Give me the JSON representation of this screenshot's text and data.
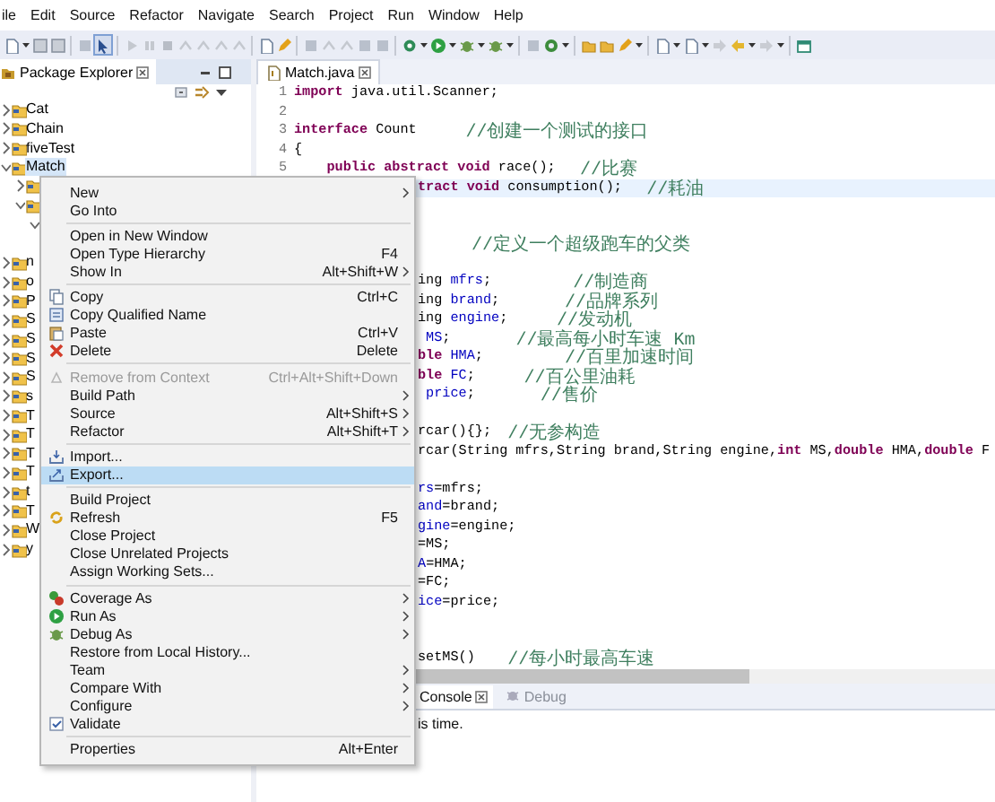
{
  "menubar": [
    "ile",
    "Edit",
    "Source",
    "Refactor",
    "Navigate",
    "Search",
    "Project",
    "Run",
    "Window",
    "Help"
  ],
  "explorer": {
    "title": "Package Explorer",
    "items": [
      {
        "label": "Cat",
        "expanded": false,
        "selected": false
      },
      {
        "label": "Chain",
        "expanded": false,
        "selected": false
      },
      {
        "label": "fiveTest",
        "expanded": false,
        "selected": false
      },
      {
        "label": "Match",
        "expanded": true,
        "selected": true,
        "children": [
          {
            "expanded": false
          },
          {
            "expanded": true,
            "children": [
              {
                "expanded": true
              }
            ]
          }
        ]
      },
      {
        "label": "n",
        "expanded": false,
        "selected": false
      },
      {
        "label": "o",
        "expanded": false,
        "selected": false
      },
      {
        "label": "P",
        "expanded": false,
        "selected": false
      },
      {
        "label": "S",
        "expanded": false,
        "selected": false
      },
      {
        "label": "S",
        "expanded": false,
        "selected": false
      },
      {
        "label": "S",
        "expanded": false,
        "selected": false
      },
      {
        "label": "S",
        "expanded": false,
        "selected": false
      },
      {
        "label": "s",
        "expanded": false,
        "selected": false
      },
      {
        "label": "T",
        "expanded": false,
        "selected": false
      },
      {
        "label": "T",
        "expanded": false,
        "selected": false
      },
      {
        "label": "T",
        "expanded": false,
        "selected": false
      },
      {
        "label": "T",
        "expanded": false,
        "selected": false
      },
      {
        "label": "t",
        "expanded": false,
        "selected": false
      },
      {
        "label": "T",
        "expanded": false,
        "selected": false
      },
      {
        "label": "W",
        "expanded": false,
        "selected": false
      },
      {
        "label": "y",
        "expanded": false,
        "selected": false
      }
    ]
  },
  "editor": {
    "tab": "Match.java",
    "lines": [
      {
        "number": "1",
        "highlighted": false,
        "segments": [
          {
            "kind": "keyword",
            "text": "import"
          },
          {
            "kind": "plain",
            "text": " java.util.Scanner;"
          }
        ]
      },
      {
        "number": "2",
        "highlighted": false
      },
      {
        "number": "3",
        "highlighted": false,
        "segments": [
          {
            "kind": "keyword",
            "text": "interface"
          },
          {
            "kind": "plain",
            "text": " Count      "
          },
          {
            "kind": "comment",
            "text": "//创建一个测试的接口"
          }
        ]
      },
      {
        "number": "4",
        "highlighted": false,
        "segments": [
          {
            "kind": "plain",
            "text": "{"
          }
        ]
      },
      {
        "number": "5",
        "highlighted": false,
        "segments": [
          {
            "kind": "keyword",
            "text": "    public abstract void"
          },
          {
            "kind": "plain",
            "text": " race();   "
          },
          {
            "kind": "comment",
            "text": "//比赛"
          }
        ]
      },
      {
        "highlighted": true,
        "segments": [
          {
            "kind": "keyword",
            "text": "tract void"
          },
          {
            "kind": "plain",
            "text": " consumption();   "
          },
          {
            "kind": "comment",
            "text": "//耗油"
          }
        ]
      },
      {
        "highlighted": false
      },
      {
        "highlighted": false
      },
      {
        "highlighted": false,
        "segments": [
          {
            "kind": "comment",
            "text": "     //定义一个超级跑车的父类"
          }
        ]
      },
      {
        "highlighted": false
      },
      {
        "highlighted": false,
        "segments": [
          {
            "kind": "plain",
            "text": "ing "
          },
          {
            "kind": "field",
            "text": "mfrs"
          },
          {
            "kind": "plain",
            "text": ";          "
          },
          {
            "kind": "comment",
            "text": "//制造商"
          }
        ]
      },
      {
        "highlighted": false,
        "segments": [
          {
            "kind": "plain",
            "text": "ing "
          },
          {
            "kind": "field",
            "text": "brand"
          },
          {
            "kind": "plain",
            "text": ";        "
          },
          {
            "kind": "comment",
            "text": "//品牌系列"
          }
        ]
      },
      {
        "highlighted": false,
        "segments": [
          {
            "kind": "plain",
            "text": "ing "
          },
          {
            "kind": "field",
            "text": "engine"
          },
          {
            "kind": "plain",
            "text": ";      "
          },
          {
            "kind": "comment",
            "text": "//发动机"
          }
        ]
      },
      {
        "highlighted": false,
        "segments": [
          {
            "kind": "field",
            "text": " MS"
          },
          {
            "kind": "plain",
            "text": ";        "
          },
          {
            "kind": "comment",
            "text": "//最高每小时车速 Km"
          }
        ]
      },
      {
        "highlighted": false,
        "segments": [
          {
            "kind": "keyword",
            "text": "ble"
          },
          {
            "kind": "field",
            "text": " HMA"
          },
          {
            "kind": "plain",
            "text": ";          "
          },
          {
            "kind": "comment",
            "text": "//百里加速时间"
          }
        ]
      },
      {
        "highlighted": false,
        "segments": [
          {
            "kind": "keyword",
            "text": "ble"
          },
          {
            "kind": "field",
            "text": " FC"
          },
          {
            "kind": "plain",
            "text": ";      "
          },
          {
            "kind": "comment",
            "text": "//百公里油耗"
          }
        ]
      },
      {
        "highlighted": false,
        "segments": [
          {
            "kind": "field",
            "text": " price"
          },
          {
            "kind": "plain",
            "text": ";        "
          },
          {
            "kind": "comment",
            "text": "//售价"
          }
        ]
      },
      {
        "highlighted": false
      },
      {
        "highlighted": false,
        "segments": [
          {
            "kind": "plain",
            "text": "rcar(){};  "
          },
          {
            "kind": "comment",
            "text": "//无参构造"
          }
        ]
      },
      {
        "highlighted": false,
        "segments": [
          {
            "kind": "plain",
            "text": "rcar(String mfrs,String brand,String engine,"
          },
          {
            "kind": "keyword",
            "text": "int"
          },
          {
            "kind": "plain",
            "text": " MS,"
          },
          {
            "kind": "keyword",
            "text": "double"
          },
          {
            "kind": "plain",
            "text": " HMA,"
          },
          {
            "kind": "keyword",
            "text": "double"
          },
          {
            "kind": "plain",
            "text": " F"
          }
        ]
      },
      {
        "highlighted": false
      },
      {
        "highlighted": false,
        "segments": [
          {
            "kind": "field",
            "text": "rs"
          },
          {
            "kind": "plain",
            "text": "=mfrs;"
          }
        ]
      },
      {
        "highlighted": false,
        "segments": [
          {
            "kind": "field",
            "text": "and"
          },
          {
            "kind": "plain",
            "text": "=brand;"
          }
        ]
      },
      {
        "highlighted": false,
        "segments": [
          {
            "kind": "field",
            "text": "gine"
          },
          {
            "kind": "plain",
            "text": "=engine;"
          }
        ]
      },
      {
        "highlighted": false,
        "segments": [
          {
            "kind": "plain",
            "text": "=MS;"
          }
        ]
      },
      {
        "highlighted": false,
        "segments": [
          {
            "kind": "field",
            "text": "A"
          },
          {
            "kind": "plain",
            "text": "=HMA;"
          }
        ]
      },
      {
        "highlighted": false,
        "segments": [
          {
            "kind": "plain",
            "text": "=FC;"
          }
        ]
      },
      {
        "highlighted": false,
        "segments": [
          {
            "kind": "field",
            "text": "ice"
          },
          {
            "kind": "plain",
            "text": "=price;"
          }
        ]
      },
      {
        "highlighted": false
      },
      {
        "highlighted": false
      },
      {
        "highlighted": false,
        "segments": [
          {
            "kind": "plain",
            "text": "setMS()    "
          },
          {
            "kind": "comment",
            "text": "//每小时最高车速"
          }
        ]
      }
    ]
  },
  "bottom": {
    "tabs": [
      {
        "label": "Console",
        "selected": true
      },
      {
        "label": "Debug",
        "selected": false
      }
    ],
    "text": "is time."
  },
  "context_menu": {
    "groups": [
      [
        {
          "label": "New",
          "submenu": true,
          "disabled": false,
          "selected": false
        },
        {
          "label": "Go Into",
          "submenu": false,
          "disabled": false,
          "selected": false
        }
      ],
      [
        {
          "label": "Open in New Window",
          "submenu": false,
          "disabled": false,
          "selected": false
        },
        {
          "label": "Open Type Hierarchy",
          "shortcut": "F4",
          "submenu": false,
          "disabled": false,
          "selected": false
        },
        {
          "label": "Show In",
          "shortcut": "Alt+Shift+W",
          "submenu": true,
          "disabled": false,
          "selected": false
        }
      ],
      [
        {
          "label": "Copy",
          "shortcut": "Ctrl+C",
          "submenu": false,
          "disabled": false,
          "selected": false
        },
        {
          "label": "Copy Qualified Name",
          "submenu": false,
          "disabled": false,
          "selected": false
        },
        {
          "label": "Paste",
          "shortcut": "Ctrl+V",
          "submenu": false,
          "disabled": false,
          "selected": false
        },
        {
          "label": "Delete",
          "shortcut": "Delete",
          "submenu": false,
          "disabled": false,
          "selected": false
        }
      ],
      [
        {
          "label": "Remove from Context",
          "shortcut": "Ctrl+Alt+Shift+Down",
          "submenu": false,
          "disabled": true,
          "selected": false
        },
        {
          "label": "Build Path",
          "submenu": true,
          "disabled": false,
          "selected": false
        },
        {
          "label": "Source",
          "shortcut": "Alt+Shift+S",
          "submenu": true,
          "disabled": false,
          "selected": false
        },
        {
          "label": "Refactor",
          "shortcut": "Alt+Shift+T",
          "submenu": true,
          "disabled": false,
          "selected": false
        }
      ],
      [
        {
          "label": "Import...",
          "submenu": false,
          "disabled": false,
          "selected": false
        },
        {
          "label": "Export...",
          "submenu": false,
          "disabled": false,
          "selected": true
        }
      ],
      [
        {
          "label": "Build Project",
          "submenu": false,
          "disabled": false,
          "selected": false
        },
        {
          "label": "Refresh",
          "shortcut": "F5",
          "submenu": false,
          "disabled": false,
          "selected": false
        },
        {
          "label": "Close Project",
          "submenu": false,
          "disabled": false,
          "selected": false
        },
        {
          "label": "Close Unrelated Projects",
          "submenu": false,
          "disabled": false,
          "selected": false
        },
        {
          "label": "Assign Working Sets...",
          "submenu": false,
          "disabled": false,
          "selected": false
        }
      ],
      [
        {
          "label": "Coverage As",
          "submenu": true,
          "disabled": false,
          "selected": false
        },
        {
          "label": "Run As",
          "submenu": true,
          "disabled": false,
          "selected": false
        },
        {
          "label": "Debug As",
          "submenu": true,
          "disabled": false,
          "selected": false
        },
        {
          "label": "Restore from Local History...",
          "submenu": false,
          "disabled": false,
          "selected": false
        },
        {
          "label": "Team",
          "submenu": true,
          "disabled": false,
          "selected": false
        },
        {
          "label": "Compare With",
          "submenu": true,
          "disabled": false,
          "selected": false
        },
        {
          "label": "Configure",
          "submenu": true,
          "disabled": false,
          "selected": false
        },
        {
          "label": "Validate",
          "submenu": false,
          "disabled": false,
          "selected": false
        }
      ],
      [
        {
          "label": "Properties",
          "shortcut": "Alt+Enter",
          "submenu": false,
          "disabled": false,
          "selected": false
        }
      ]
    ]
  }
}
